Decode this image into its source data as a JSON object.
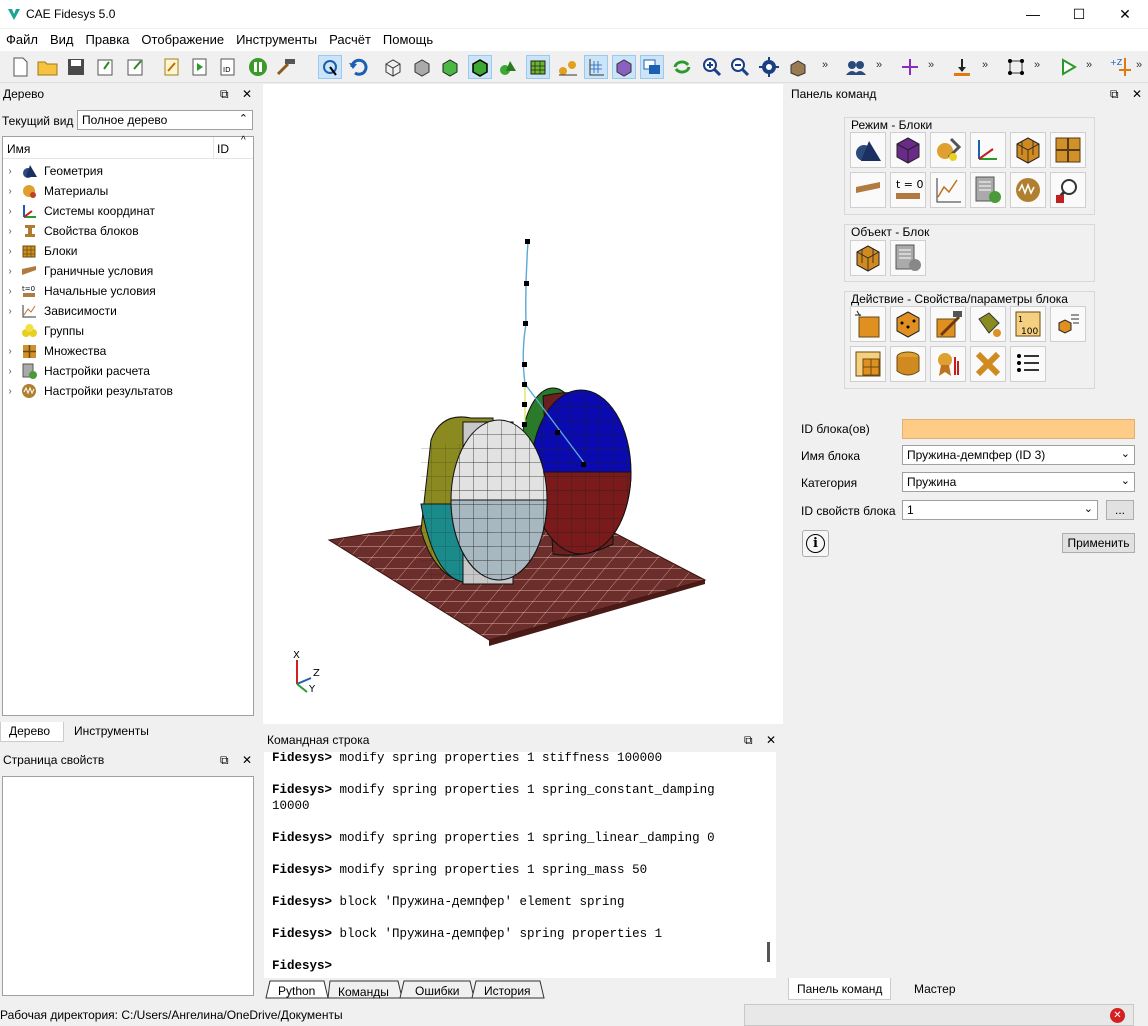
{
  "window": {
    "title": "CAE Fidesys 5.0",
    "minimize_glyph": "—",
    "maximize_glyph": "☐",
    "close_glyph": "✕"
  },
  "menu": [
    "Файл",
    "Вид",
    "Правка",
    "Отображение",
    "Инструменты",
    "Расчёт",
    "Помощь"
  ],
  "tree_panel": {
    "title": "Дерево",
    "view_label": "Текущий вид",
    "view_value": "Полное дерево",
    "col_name": "Имя",
    "col_id": "ID",
    "items": [
      {
        "label": "Геометрия",
        "icon": "geometry-icon"
      },
      {
        "label": "Материалы",
        "icon": "materials-icon"
      },
      {
        "label": "Системы координат",
        "icon": "coord-system-icon"
      },
      {
        "label": "Свойства блоков",
        "icon": "block-properties-icon"
      },
      {
        "label": "Блоки",
        "icon": "blocks-icon"
      },
      {
        "label": "Граничные условия",
        "icon": "boundary-conditions-icon"
      },
      {
        "label": "Начальные условия",
        "icon": "initial-conditions-icon"
      },
      {
        "label": "Зависимости",
        "icon": "dependencies-icon"
      },
      {
        "label": "Группы",
        "icon": "groups-icon"
      },
      {
        "label": "Множества",
        "icon": "sets-icon"
      },
      {
        "label": "Настройки расчета",
        "icon": "analysis-settings-icon"
      },
      {
        "label": "Настройки результатов",
        "icon": "results-settings-icon"
      }
    ],
    "tabs": [
      "Дерево",
      "Инструменты"
    ]
  },
  "properties_panel": {
    "title": "Страница свойств"
  },
  "console": {
    "title": "Командная строка",
    "lines": [
      {
        "prompt": "Fidesys>",
        "cmd": " modify spring properties 1 stiffness 100000"
      },
      {
        "prompt": "",
        "cmd": ""
      },
      {
        "prompt": "Fidesys>",
        "cmd": " modify spring properties 1 spring_constant_damping"
      },
      {
        "prompt": "",
        "cmd": "10000"
      },
      {
        "prompt": "",
        "cmd": ""
      },
      {
        "prompt": "Fidesys>",
        "cmd": " modify spring properties 1 spring_linear_damping 0"
      },
      {
        "prompt": "",
        "cmd": ""
      },
      {
        "prompt": "Fidesys>",
        "cmd": " modify spring properties 1 spring_mass 50"
      },
      {
        "prompt": "",
        "cmd": ""
      },
      {
        "prompt": "Fidesys>",
        "cmd": " block 'Пружина-демпфер' element spring"
      },
      {
        "prompt": "",
        "cmd": ""
      },
      {
        "prompt": "Fidesys>",
        "cmd": " block 'Пружина-демпфер' spring properties 1"
      },
      {
        "prompt": "",
        "cmd": ""
      },
      {
        "prompt": "Fidesys>",
        "cmd": ""
      }
    ],
    "tabs": [
      "Python",
      "Команды",
      "Ошибки",
      "История"
    ]
  },
  "viewport": {
    "axis_x": "X",
    "axis_y": "Y",
    "axis_z": "Z"
  },
  "command_panel": {
    "title": "Панель команд",
    "mode_group": "Режим - Блоки",
    "object_group": "Объект - Блок",
    "action_group": "Действие - Свойства/параметры блока",
    "t0_label": "t = 0",
    "n100_label": "100",
    "form": {
      "block_ids_label": "ID блока(ов)",
      "block_ids_value": "",
      "block_name_label": "Имя блока",
      "block_name_value": "Пружина-демпфер (ID 3)",
      "category_label": "Категория",
      "category_value": "Пружина",
      "props_id_label": "ID свойств блока",
      "props_id_value": "1",
      "browse_label": "...",
      "apply_label": "Применить",
      "info_glyph": "i"
    },
    "tabs": [
      "Панель команд",
      "Мастер"
    ]
  },
  "statusbar": {
    "workdir": "Рабочая директория: C:/Users/Ангелина/OneDrive/Документы"
  },
  "colors": {
    "accent": "#0078d7",
    "highlight_field": "#ffcc88",
    "mesh_floor": "#6b2e2a"
  }
}
